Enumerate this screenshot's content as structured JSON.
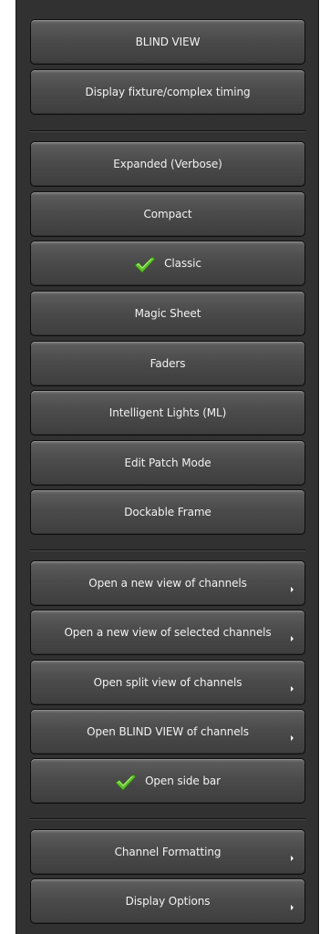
{
  "menu": {
    "groups": [
      {
        "items": [
          {
            "label": "BLIND VIEW",
            "checked": false,
            "submenu": false
          },
          {
            "label": "Display fixture/complex timing",
            "checked": false,
            "submenu": false
          }
        ]
      },
      {
        "items": [
          {
            "label": "Expanded (Verbose)",
            "checked": false,
            "submenu": false
          },
          {
            "label": "Compact",
            "checked": false,
            "submenu": false
          },
          {
            "label": "Classic",
            "checked": true,
            "submenu": false
          },
          {
            "label": "Magic Sheet",
            "checked": false,
            "submenu": false
          },
          {
            "label": "Faders",
            "checked": false,
            "submenu": false
          },
          {
            "label": "Intelligent Lights (ML)",
            "checked": false,
            "submenu": false
          },
          {
            "label": "Edit Patch Mode",
            "checked": false,
            "submenu": false
          },
          {
            "label": "Dockable Frame",
            "checked": false,
            "submenu": false
          }
        ]
      },
      {
        "items": [
          {
            "label": "Open a new view of channels",
            "checked": false,
            "submenu": true
          },
          {
            "label": "Open a new view of selected channels",
            "checked": false,
            "submenu": true
          },
          {
            "label": "Open split view of channels",
            "checked": false,
            "submenu": true
          },
          {
            "label": "Open BLIND VIEW of channels",
            "checked": false,
            "submenu": true
          },
          {
            "label": "Open side bar",
            "checked": true,
            "submenu": false
          }
        ]
      },
      {
        "items": [
          {
            "label": "Channel Formatting",
            "checked": false,
            "submenu": true
          },
          {
            "label": "Display Options",
            "checked": false,
            "submenu": true
          }
        ]
      }
    ]
  },
  "icons": {
    "check": "green-checkmark-icon",
    "submenu": "submenu-arrow-icon"
  },
  "colors": {
    "panel_bg": "#313131",
    "button_text": "#f2f2f2",
    "check_green": "#5fc32a"
  }
}
